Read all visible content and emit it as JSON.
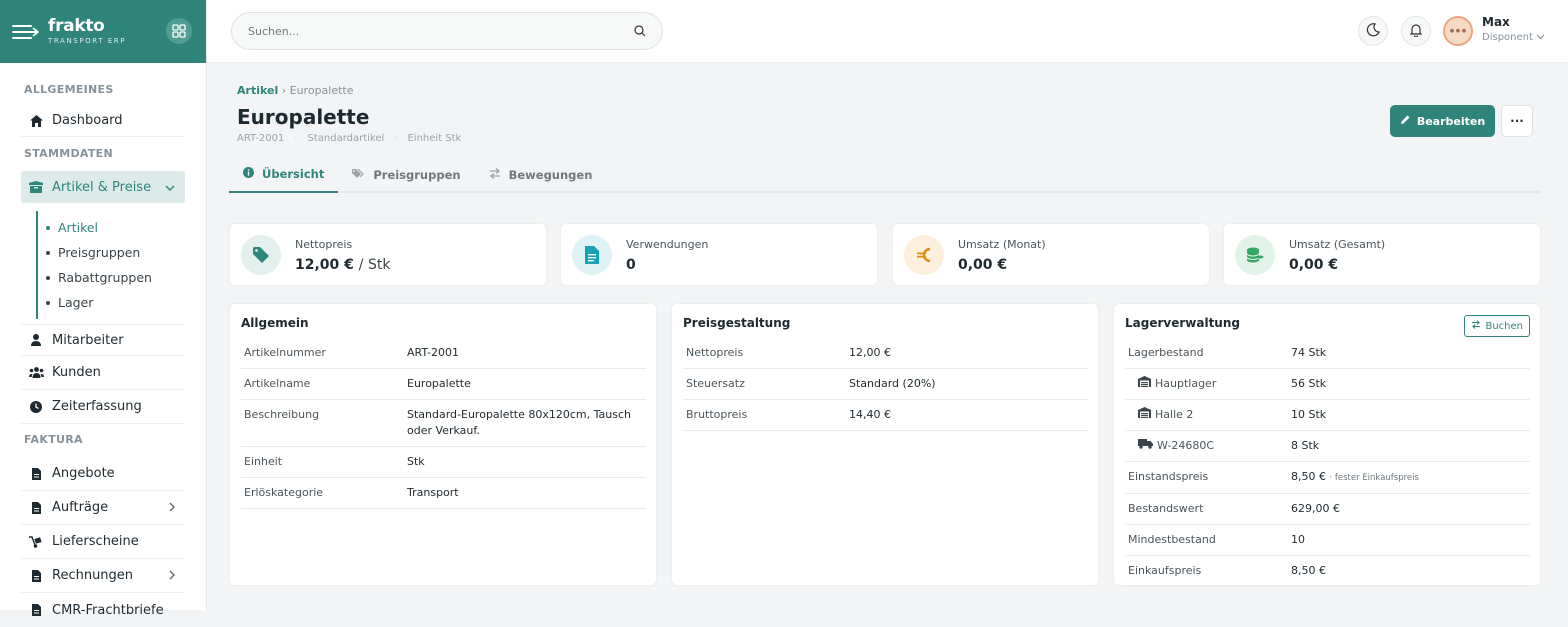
{
  "brand": {
    "name": "frakto",
    "subtitle": "TRANSPORT ERP"
  },
  "search": {
    "placeholder": "Suchen..."
  },
  "user": {
    "name": "Max",
    "role": "Disponent"
  },
  "sidebar": {
    "sections": [
      "ALLGEMEINES",
      "STAMMDATEN",
      "FAKTURA"
    ],
    "items": [
      {
        "label": "Dashboard",
        "icon": "home-icon"
      },
      {
        "label": "Artikel & Preise",
        "icon": "box-icon"
      },
      {
        "label": "Mitarbeiter",
        "icon": "user-icon"
      },
      {
        "label": "Kunden",
        "icon": "users-icon"
      },
      {
        "label": "Zeiterfassung",
        "icon": "clock-icon"
      },
      {
        "label": "Angebote",
        "icon": "document-icon"
      },
      {
        "label": "Aufträge",
        "icon": "document-icon"
      },
      {
        "label": "Lieferscheine",
        "icon": "dolly-icon"
      },
      {
        "label": "Rechnungen",
        "icon": "document-icon"
      },
      {
        "label": "CMR-Frachtbriefe",
        "icon": "document-icon"
      }
    ],
    "subitems": [
      "Artikel",
      "Preisgruppen",
      "Rabattgruppen",
      "Lager"
    ]
  },
  "page": {
    "breadcrumb": {
      "root": "Artikel",
      "sep": "›",
      "current": "Europalette"
    },
    "title": "Europalette",
    "meta": [
      "ART-2001",
      "Standardartikel",
      "Einheit Stk"
    ],
    "meta_sep": "·",
    "edit_label": "Bearbeiten",
    "more_label": "···",
    "tabs": [
      "Übersicht",
      "Preisgruppen",
      "Bewegungen"
    ]
  },
  "stats": [
    {
      "label": "Nettopreis",
      "value": "12,00 €",
      "unit": "/ Stk",
      "color": "#2f857c",
      "bg": "#e3f0ee"
    },
    {
      "label": "Verwendungen",
      "value": "0",
      "unit": "",
      "color": "#17a2b8",
      "bg": "#dff3f6"
    },
    {
      "label": "Umsatz (Monat)",
      "value": "0,00 €",
      "unit": "",
      "color": "#e08e0b",
      "bg": "#fcf0dc"
    },
    {
      "label": "Umsatz (Gesamt)",
      "value": "0,00 €",
      "unit": "",
      "color": "#35a866",
      "bg": "#e2f4e9"
    }
  ],
  "allgemein": {
    "title": "Allgemein",
    "rows": [
      {
        "k": "Artikelnummer",
        "v": "ART-2001"
      },
      {
        "k": "Artikelname",
        "v": "Europalette"
      },
      {
        "k": "Beschreibung",
        "v": "Standard-Europalette 80x120cm, Tausch oder Verkauf."
      },
      {
        "k": "Einheit",
        "v": "Stk"
      },
      {
        "k": "Erlöskategorie",
        "v": "Transport"
      }
    ]
  },
  "preis": {
    "title": "Preisgestaltung",
    "rows": [
      {
        "k": "Nettopreis",
        "v": "12,00 €"
      },
      {
        "k": "Steuersatz",
        "v": "Standard (20%)"
      },
      {
        "k": "Bruttopreis",
        "v": "14,40 €"
      }
    ]
  },
  "lager": {
    "title": "Lagerverwaltung",
    "book_label": "Buchen",
    "rows": [
      {
        "k": "Lagerbestand",
        "v": "74 Stk",
        "note": ""
      },
      {
        "k": "Hauptlager",
        "v": "56 Stk",
        "note": ""
      },
      {
        "k": "Halle 2",
        "v": "10 Stk",
        "note": ""
      },
      {
        "k": "W-24680C",
        "v": "8 Stk",
        "note": ""
      },
      {
        "k": "Einstandspreis",
        "v": "8,50 €",
        "note": "· fester Einkaufspreis"
      },
      {
        "k": "Bestandswert",
        "v": "629,00 €",
        "note": ""
      },
      {
        "k": "Mindestbestand",
        "v": "10",
        "note": ""
      },
      {
        "k": "Einkaufspreis",
        "v": "8,50 €",
        "note": ""
      }
    ]
  }
}
